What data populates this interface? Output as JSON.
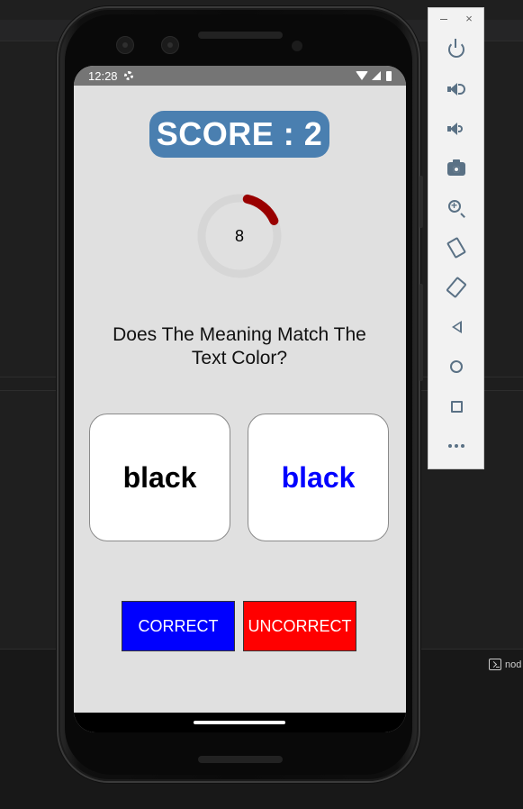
{
  "status_bar": {
    "time": "12:28"
  },
  "game": {
    "score_label": "SCORE : 2",
    "timer_value": "8",
    "timer_progress": 0.15,
    "question": "Does The Meaning Match The Text Color?",
    "left_card": {
      "word": "black",
      "color": "#000000"
    },
    "right_card": {
      "word": "black",
      "color": "#0000ff"
    },
    "buttons": {
      "correct_label": "CORRECT",
      "correct_color": "#0000ff",
      "uncorrect_label": "UNCORRECT",
      "uncorrect_color": "#ff0000"
    }
  },
  "colors": {
    "score_pill": "#4a7fb0",
    "timer_track": "#d6d6d6",
    "timer_arc": "#990000",
    "screen_bg": "#e0e0e0"
  },
  "emulator_toolbar": {
    "window_close": "×",
    "items": [
      "power-icon",
      "volume-up-icon",
      "volume-down-icon",
      "screenshot-icon",
      "zoom-icon",
      "rotate-left-icon",
      "rotate-right-icon",
      "back-icon",
      "home-icon",
      "overview-icon",
      "more-icon"
    ]
  },
  "terminal": {
    "tab_label": "nod"
  }
}
